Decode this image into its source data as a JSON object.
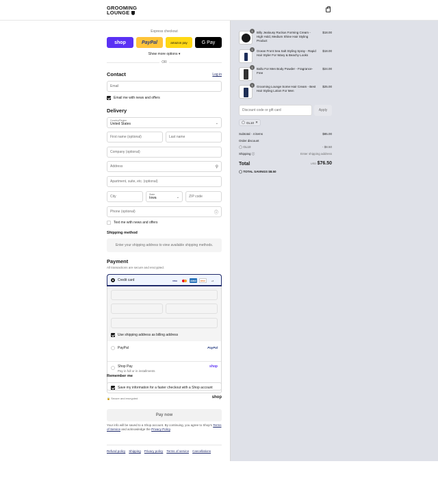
{
  "header": {
    "logo_line1": "GROOMING",
    "logo_line2": "LOUNGE"
  },
  "express": {
    "title": "Express checkout",
    "shop_label": "shop",
    "paypal_label": "PayPal",
    "amazon_label": "amazon pay",
    "gpay_label": "G Pay",
    "more_options": "Show more options ▾",
    "or": "OR"
  },
  "contact": {
    "heading": "Contact",
    "login": "Log in",
    "email_placeholder": "Email",
    "news_label": "Email me with news and offers",
    "news_checked": true
  },
  "delivery": {
    "heading": "Delivery",
    "country_label": "Country/Region",
    "country_value": "United States",
    "first_name": "First name (optional)",
    "last_name": "Last name",
    "company": "Company (optional)",
    "address": "Address",
    "apartment": "Apartment, suite, etc. (optional)",
    "city": "City",
    "state_label": "State",
    "state_value": "Iowa",
    "zip": "ZIP code",
    "phone": "Phone (optional)",
    "text_label": "Text me with news and offers",
    "text_checked": false
  },
  "shipping": {
    "heading": "Shipping method",
    "note": "Enter your shipping address to view available shipping methods."
  },
  "payment": {
    "heading": "Payment",
    "subtitle": "All transactions are secure and encrypted.",
    "credit_card": "Credit card",
    "card_brands": [
      "VISA",
      "MC",
      "AMEX",
      "DISC",
      "+4"
    ],
    "billing_label": "Use shipping address as billing address",
    "billing_checked": true,
    "paypal": "PayPal",
    "paypal_logo": "PayPal",
    "shop_pay": "Shop Pay",
    "shop_pay_sub": "Pay in full or in installments",
    "shop_pay_logo": "shop"
  },
  "remember": {
    "heading": "Remember me",
    "save_label": "Save my information for a faster checkout with a Shop account",
    "save_checked": true,
    "secure": "Secure and encrypted",
    "shop_logo": "shop"
  },
  "pay_now": "Pay now",
  "fine_print": {
    "text1": "Your info will be saved to a Shop account. By continuing, you agree to Shop's",
    "terms": "Terms of Service",
    "text2": "and acknowledge the",
    "privacy": "Privacy Policy",
    "end": "."
  },
  "footer_links": [
    "Refund policy",
    "Shipping",
    "Privacy policy",
    "Terms of service",
    "Cancellations"
  ],
  "cart": {
    "items": [
      {
        "qty": "1",
        "name": "Billy Jealousy Ruckus Forming Cream - High Hold, Medium Shine Hair Styling Product",
        "price": "$18.00"
      },
      {
        "qty": "1",
        "name": "Ocean Front Sea Salt Styling Spray - Rapid Hair Styler For Wavy & Beachy Looks",
        "price": "$18.00"
      },
      {
        "qty": "1",
        "name": "Ballu For Men Body Powder - Fragrance-Free",
        "price": "$24.00"
      },
      {
        "qty": "1",
        "name": "Grooming Lounge Some Hair Cream - Best Hair Styling Lotion For Men",
        "price": "$25.00"
      }
    ],
    "discount_placeholder": "Discount code or gift card",
    "apply": "Apply",
    "code_chip": "GL10",
    "subtotal_label": "Subtotal · 4 items",
    "subtotal": "$85.00",
    "order_discount": "Order discount",
    "discount_code": "GL10",
    "discount_amount": "- $8.50",
    "shipping_label": "Shipping",
    "shipping_value": "Enter shipping address",
    "total_label": "Total",
    "currency": "USD",
    "total": "$76.50",
    "savings_label": "TOTAL SAVINGS",
    "savings": "$8.50"
  },
  "colors": {
    "shop_purple": "#5a31f4",
    "paypal_yellow": "#ffc439",
    "amazon_yellow": "#ffd814",
    "link_blue": "#1f2a6b",
    "summary_bg": "#dfe1e8"
  }
}
